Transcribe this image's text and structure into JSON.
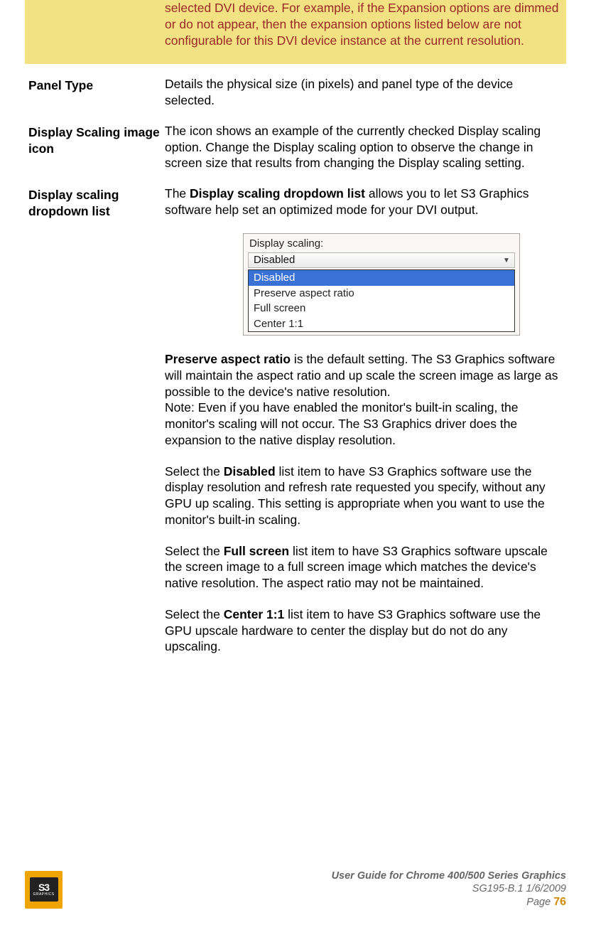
{
  "note": {
    "text": "selected DVI device. For example, if the Expansion options are dimmed or do not appear, then the expansion options listed below are not configurable for this DVI device instance at the current resolution."
  },
  "rows": {
    "panelType": {
      "label": "Panel Type",
      "text": "Details the physical size (in pixels) and panel type of the device selected."
    },
    "scalingIcon": {
      "label": "Display Scaling image icon",
      "text": "The icon shows an example of the currently checked Display scaling option. Change the Display scaling option to observe the change in screen size that results from changing the Display scaling setting."
    },
    "scalingList": {
      "label": "Display scaling dropdown list",
      "intro_pre": "The ",
      "intro_bold": "Display scaling dropdown list",
      "intro_post": " allows you to let S3 Graphics software help set an optimized mode for your DVI output.",
      "pres_bold": "Preserve aspect ratio",
      "pres_rest": " is the default setting. The S3 Graphics software will maintain the aspect ratio and up scale the screen image as large as possible to the device's native resolution.",
      "pres_note": "Note: Even if you have enabled the monitor's built-in scaling, the monitor's scaling will not occur. The S3 Graphics driver does the expansion to the native display resolution.",
      "dis_pre": "Select the ",
      "dis_bold": "Disabled",
      "dis_post": " list item to have S3 Graphics software use the display resolution and refresh rate requested you specify, without any GPU up scaling. This setting is appropriate when you want to use the monitor's built-in scaling.",
      "full_pre": "Select the ",
      "full_bold": "Full screen",
      "full_post": " list item to have S3 Graphics software upscale the screen image to a full screen image which matches the device's native resolution. The aspect ratio may not be maintained.",
      "ctr_pre": "Select the ",
      "ctr_bold": "Center 1:1",
      "ctr_post": " list item to have S3 Graphics software use the GPU upscale hardware to center the display but do not do any upscaling."
    }
  },
  "dropdown": {
    "label": "Display scaling:",
    "selected": "Disabled",
    "items": {
      "i0": "Disabled",
      "i1": "Preserve aspect ratio",
      "i2": "Full screen",
      "i3": "Center 1:1"
    }
  },
  "footer": {
    "logo": {
      "brand": "S3",
      "sub": "GRAPHICS"
    },
    "line1": "User Guide for Chrome 400/500 Series Graphics",
    "line2": "SG195-B.1   1/6/2009",
    "page_label": "Page ",
    "page_num": "76"
  }
}
